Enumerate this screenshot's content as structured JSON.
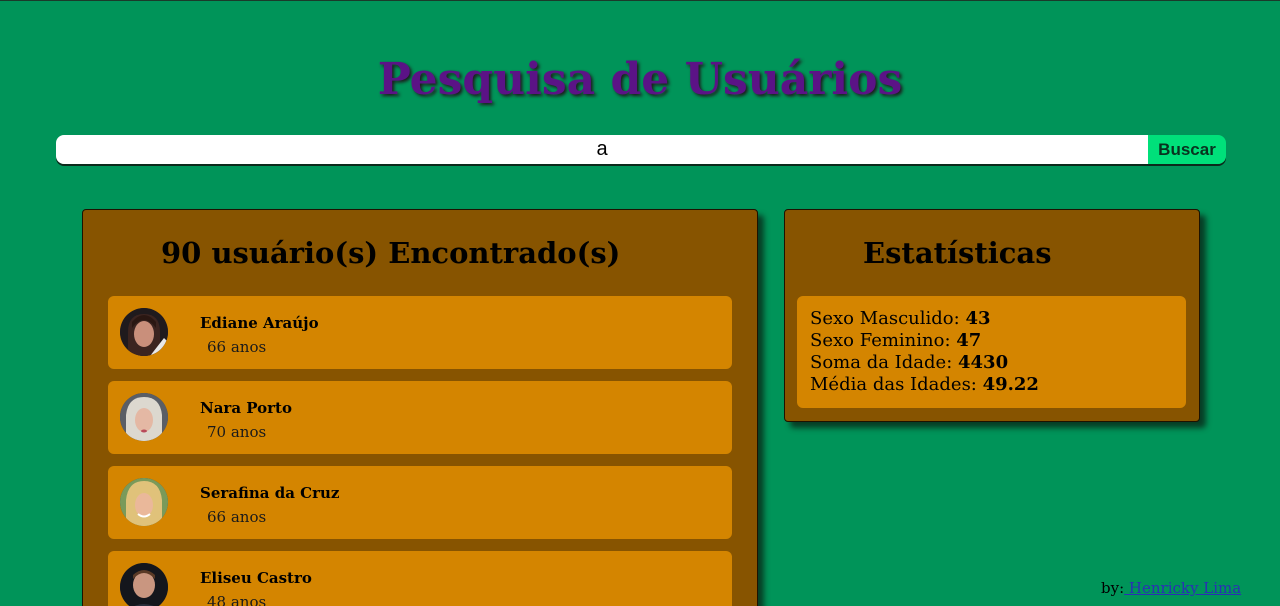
{
  "page": {
    "title": "Pesquisa de Usuários"
  },
  "search": {
    "value": "a",
    "button_label": "Buscar"
  },
  "users_panel": {
    "heading": "90 usuário(s) Encontrado(s)",
    "users": [
      {
        "name": "Ediane Araújo",
        "age": "66 anos"
      },
      {
        "name": "Nara Porto",
        "age": "70 anos"
      },
      {
        "name": "Serafina da Cruz",
        "age": "66 anos"
      },
      {
        "name": "Eliseu Castro",
        "age": "48 anos"
      }
    ]
  },
  "stats_panel": {
    "heading": "Estatísticas",
    "male_label": "Sexo Masculido: ",
    "male_value": "43",
    "female_label": "Sexo Feminino: ",
    "female_value": "47",
    "age_sum_label": "Soma da Idade: ",
    "age_sum_value": "4430",
    "age_avg_label": "Média das Idades: ",
    "age_avg_value": "49.22"
  },
  "footer": {
    "by_label": "by:",
    "author_link": " Henricky Lima"
  },
  "colors": {
    "background": "#009459",
    "title": "#5b1386",
    "panel": "#875400",
    "card": "#d48500",
    "button": "#00e07a"
  }
}
